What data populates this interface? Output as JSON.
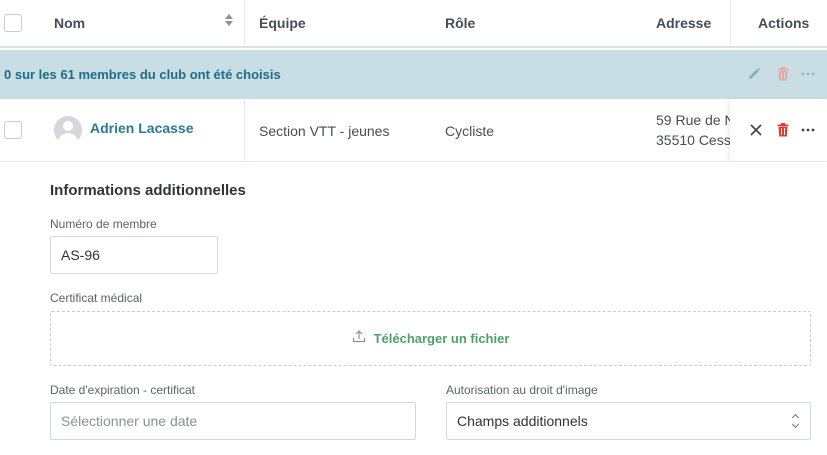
{
  "table": {
    "headers": {
      "name": "Nom",
      "team": "Équipe",
      "role": "Rôle",
      "address": "Adresse",
      "actions": "Actions"
    }
  },
  "selection": {
    "message": "0 sur les 61 membres du club ont été choisis"
  },
  "member": {
    "name": "Adrien Lacasse",
    "team": "Section VTT - jeunes",
    "role": "Cycliste",
    "address_line1": "59 Rue de N",
    "address_line2": "35510 Cess"
  },
  "details": {
    "title": "Informations additionnelles",
    "member_number": {
      "label": "Numéro de membre",
      "value": "AS-96"
    },
    "medical_certificate": {
      "label": "Certificat médical",
      "upload_label": "Télécharger un fichier"
    },
    "certificate_expiry": {
      "label": "Date d'expiration - certificat",
      "placeholder": "Sélectionner une date"
    },
    "image_rights": {
      "label": "Autorisation au droit d'image",
      "selected": "Champs additionnels"
    }
  },
  "colors": {
    "accent_teal": "#2a7a90",
    "banner_bg": "#c8dde4",
    "delete_red": "#e03b2f",
    "upload_green": "#4fa06a"
  },
  "icons": {
    "sort": "sort-icon",
    "edit": "pencil-icon",
    "delete": "trash-icon",
    "more": "ellipsis-icon",
    "close": "close-icon",
    "upload": "upload-icon",
    "avatar": "user-avatar-icon",
    "select": "chevron-up-down-icon"
  }
}
